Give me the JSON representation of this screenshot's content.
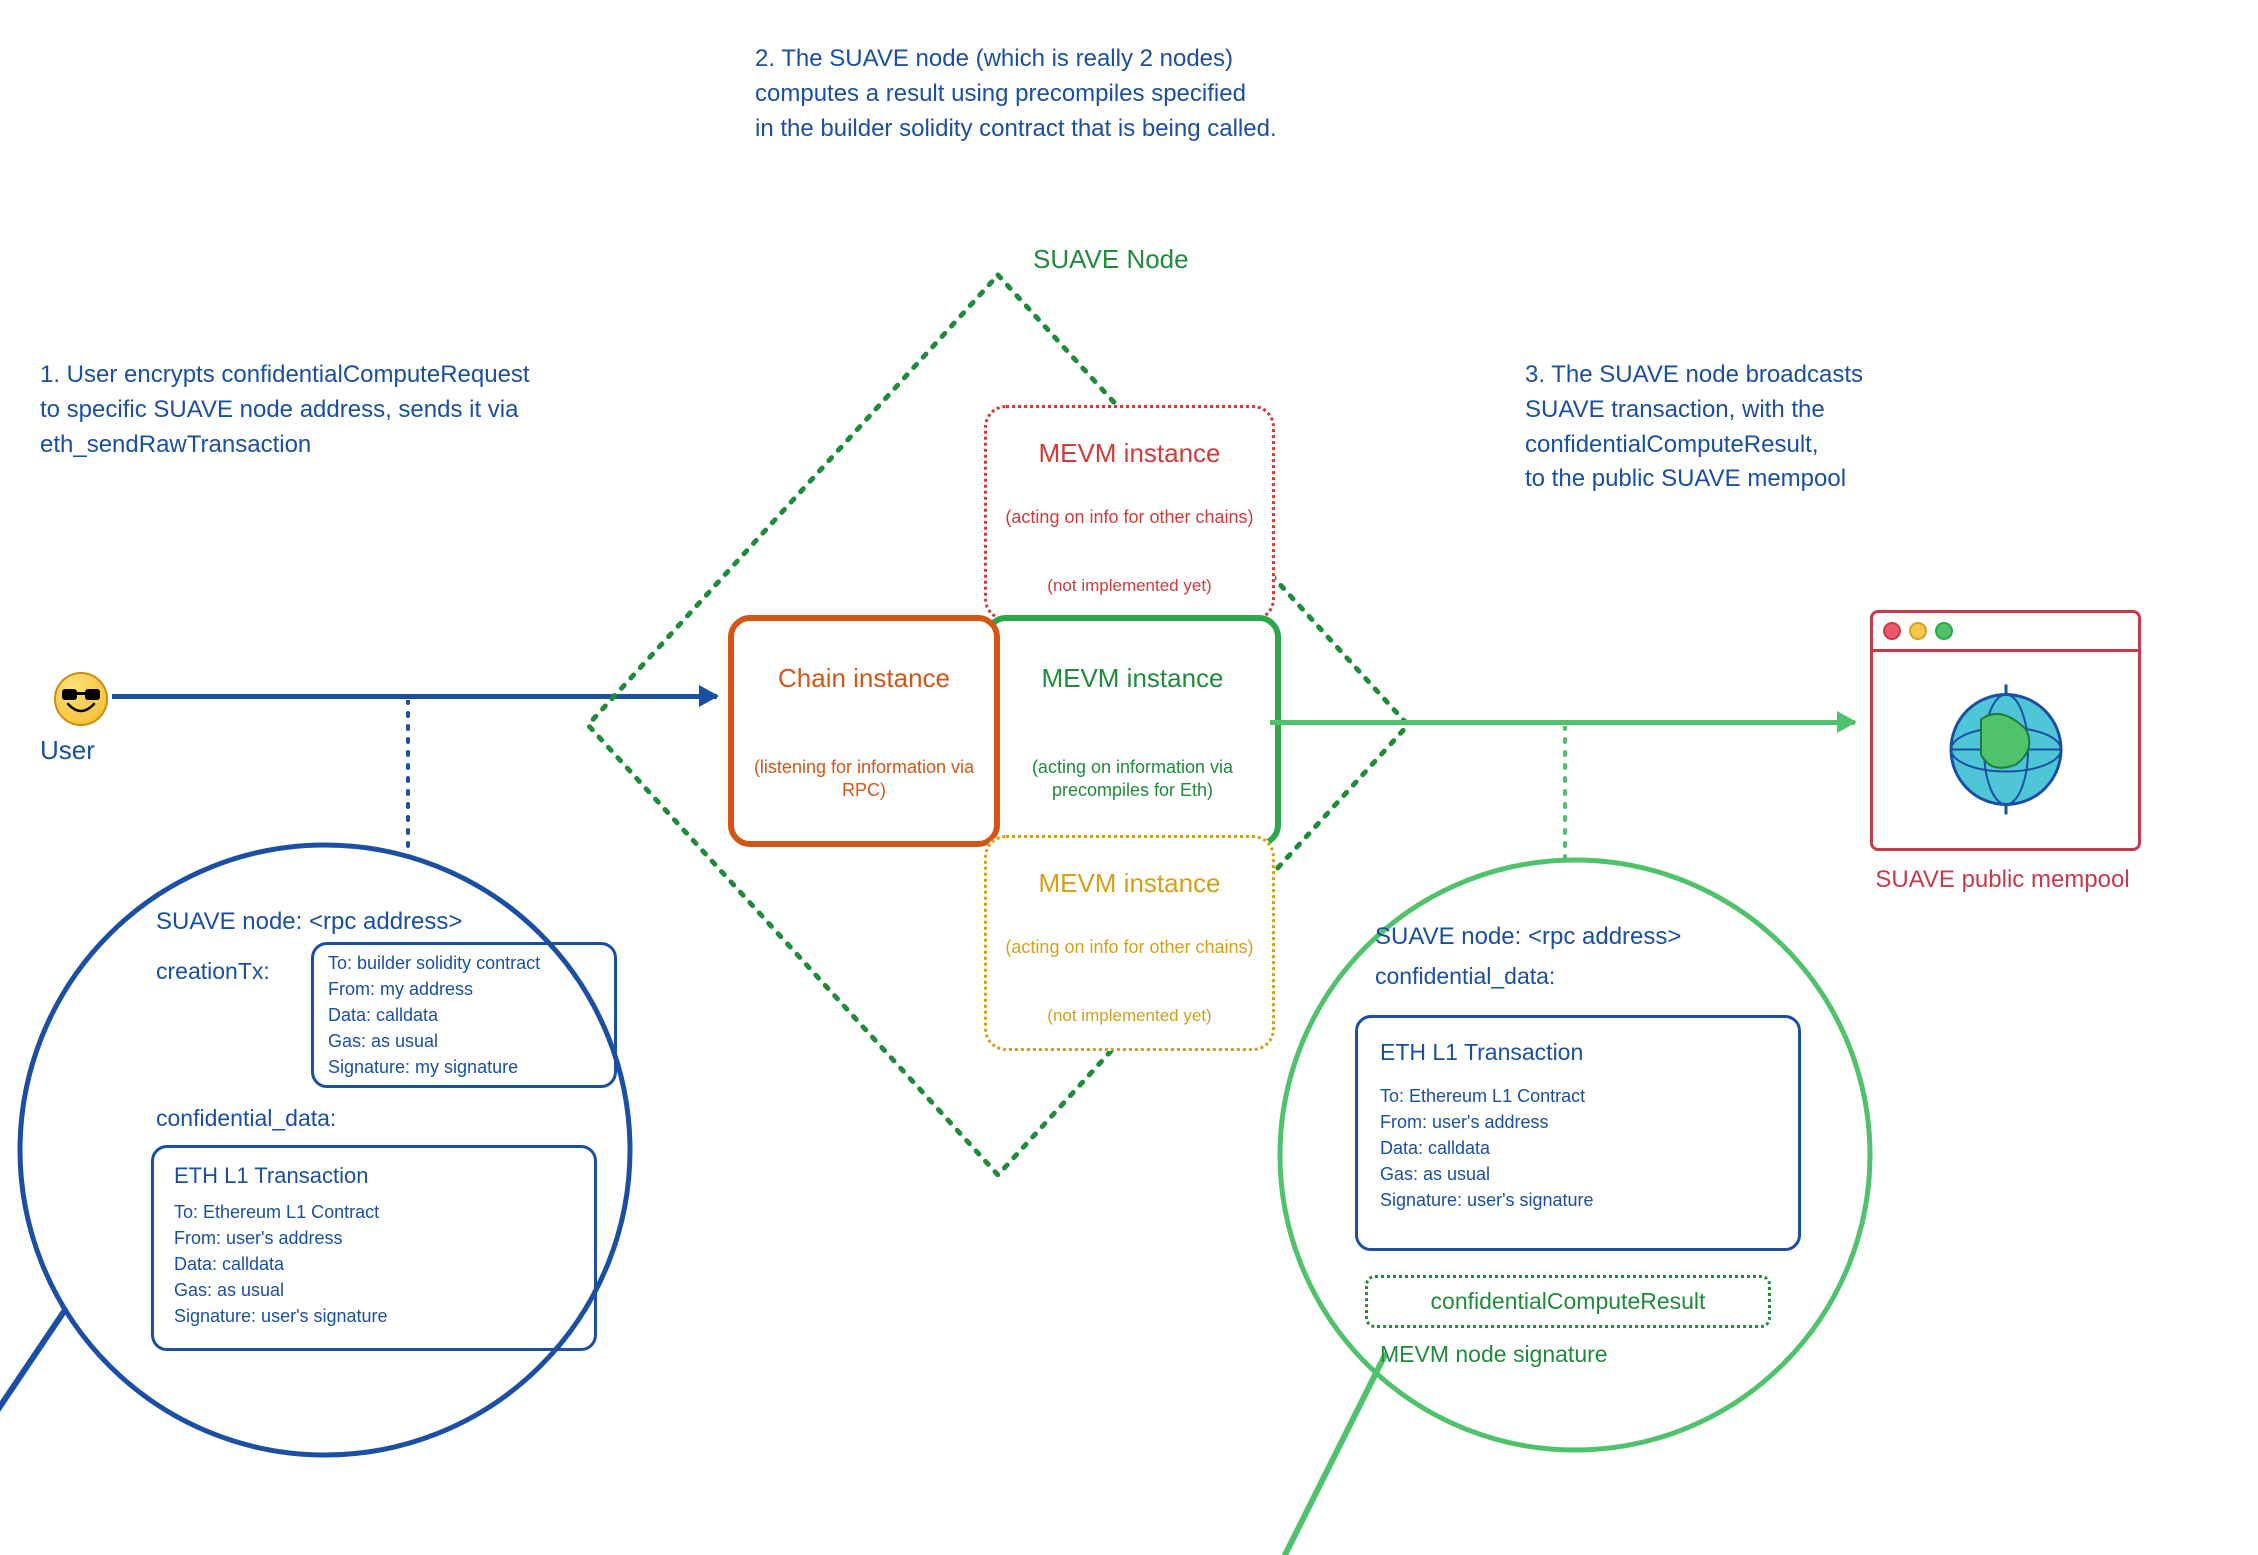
{
  "annotations": {
    "step1": "1. User encrypts confidentialComputeRequest\nto specific SUAVE node address, sends it via\neth_sendRawTransaction",
    "step2": "2. The SUAVE node (which is really 2 nodes)\ncomputes a result using precompiles specified\nin the builder solidity contract that is being called.",
    "step3": "3. The SUAVE node broadcasts\nSUAVE transaction, with the\nconfidentialComputeResult,\nto the public SUAVE mempool"
  },
  "user_label": "User",
  "suave_node_label": "SUAVE Node",
  "chain_instance": {
    "title": "Chain instance",
    "subtitle": "(listening for information\nvia RPC)"
  },
  "mevm_main": {
    "title": "MEVM instance",
    "subtitle": "(acting on information\nvia precompiles for Eth)"
  },
  "mevm_top": {
    "title": "MEVM instance",
    "subtitle": "(acting on info for\nother chains)",
    "note": "(not implemented yet)"
  },
  "mevm_bottom": {
    "title": "MEVM instance",
    "subtitle": "(acting on info for\nother chains)",
    "note": "(not implemented yet)"
  },
  "mempool_label": "SUAVE public mempool",
  "magnifier_left": {
    "header": "SUAVE node: <rpc address>",
    "creationTx_label": "creationTx:",
    "creationTx": {
      "line1": "To: builder solidity contract",
      "line2": "From: my address",
      "line3": "Data: calldata",
      "line4": "Gas: as usual",
      "line5": "Signature: my signature"
    },
    "confidential_label": "confidential_data:",
    "eth_tx": {
      "title": "ETH L1 Transaction",
      "line1": "To: Ethereum L1 Contract",
      "line2": "From: user's address",
      "line3": "Data: calldata",
      "line4": "Gas: as usual",
      "line5": "Signature: user's signature"
    }
  },
  "magnifier_right": {
    "header": "SUAVE node: <rpc address>",
    "confidential_label": "confidential_data:",
    "eth_tx": {
      "title": "ETH L1 Transaction",
      "line1": "To: Ethereum L1 Contract",
      "line2": "From: user's address",
      "line3": "Data: calldata",
      "line4": "Gas: as usual",
      "line5": "Signature: user's signature"
    },
    "ccr_label": "confidentialComputeResult",
    "sig_label": "MEVM node signature"
  }
}
